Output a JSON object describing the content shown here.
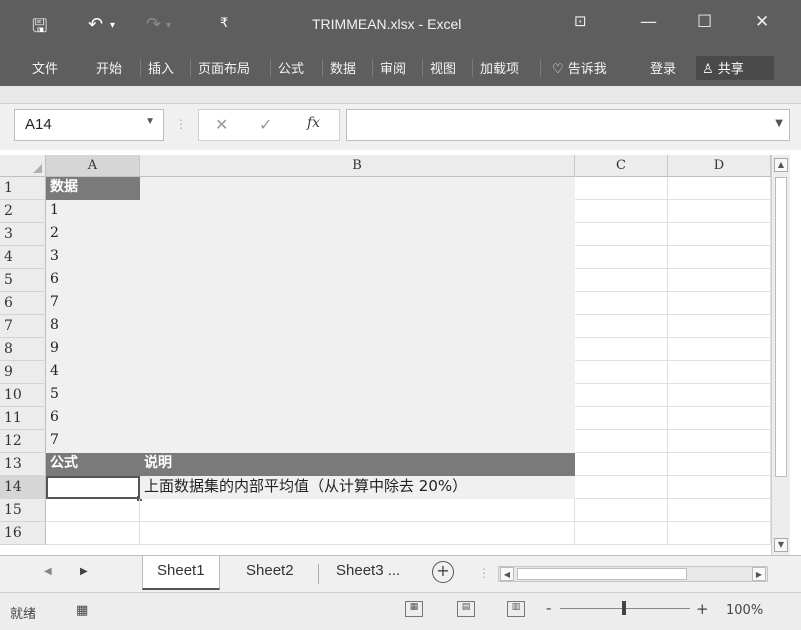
{
  "window": {
    "title": "TRIMMEAN.xlsx - Excel",
    "controls": {
      "minimize": "—",
      "maximize": "☐",
      "close": "✕"
    }
  },
  "quick_access": {
    "save_icon": "save-icon",
    "undo_icon": "undo-icon",
    "redo_icon": "redo-icon",
    "customize_icon": "customize-icon"
  },
  "ribbon": {
    "tabs": [
      "文件",
      "开始",
      "插入",
      "页面布局",
      "公式",
      "数据",
      "审阅",
      "视图",
      "加载项"
    ],
    "tell_me": "告诉我",
    "login": "登录",
    "share": "共享"
  },
  "formula_bar": {
    "name_box": "A14",
    "cancel": "✕",
    "enter": "✓",
    "fx": "fx",
    "value": ""
  },
  "columns": [
    "A",
    "B",
    "C",
    "D"
  ],
  "rows": [
    {
      "num": "1",
      "a": "数据",
      "b": ""
    },
    {
      "num": "2",
      "a": "1",
      "b": ""
    },
    {
      "num": "3",
      "a": "2",
      "b": ""
    },
    {
      "num": "4",
      "a": "3",
      "b": ""
    },
    {
      "num": "5",
      "a": "6",
      "b": ""
    },
    {
      "num": "6",
      "a": "7",
      "b": ""
    },
    {
      "num": "7",
      "a": "8",
      "b": ""
    },
    {
      "num": "8",
      "a": "9",
      "b": ""
    },
    {
      "num": "9",
      "a": "4",
      "b": ""
    },
    {
      "num": "10",
      "a": "5",
      "b": ""
    },
    {
      "num": "11",
      "a": "6",
      "b": ""
    },
    {
      "num": "12",
      "a": "7",
      "b": ""
    },
    {
      "num": "13",
      "a": "公式",
      "b": "说明"
    },
    {
      "num": "14",
      "a": "",
      "b": "上面数据集的内部平均值（从计算中除去 20%）"
    },
    {
      "num": "15",
      "a": "",
      "b": ""
    },
    {
      "num": "16",
      "a": "",
      "b": ""
    }
  ],
  "sheets": {
    "tabs": [
      "Sheet1",
      "Sheet2",
      "Sheet3 ..."
    ],
    "active": "Sheet1",
    "add": "+"
  },
  "status": {
    "ready": "就绪",
    "zoom": "100%",
    "zoom_minus": "-",
    "zoom_plus": "+"
  },
  "colors": {
    "titlebar": "#5e5e5e",
    "header_fill": "#7a7a7a",
    "data_fill": "#f0f0f0"
  }
}
